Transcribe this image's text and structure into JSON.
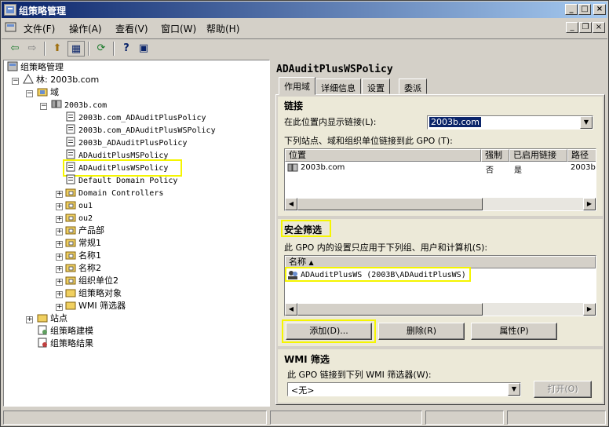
{
  "window": {
    "title": "组策略管理",
    "min_label": "_",
    "max_label": "□",
    "close_label": "×",
    "mdi_min": "_",
    "mdi_restore": "❐",
    "mdi_close": "×"
  },
  "menu": [
    {
      "label": "文件(F)"
    },
    {
      "label": "操作(A)"
    },
    {
      "label": "查看(V)"
    },
    {
      "label": "窗口(W)"
    },
    {
      "label": "帮助(H)"
    }
  ],
  "toolbar": {
    "back": "⇦",
    "forward": "⇨",
    "up": "⬆",
    "tree": "▦",
    "refresh": "⟳",
    "help": "?",
    "console": "▣"
  },
  "tree": {
    "root": "组策略管理",
    "forest": "林: 2003b.com",
    "domains": "域",
    "domain": "2003b.com",
    "gpos": [
      "2003b.com_ADAuditPlusPolicy",
      "2003b.com_ADAuditPlusWSPolicy",
      "2003b_ADAuditPlusPolicy",
      "ADAuditPlusMSPolicy",
      "ADAuditPlusWSPolicy",
      "Default Domain Policy"
    ],
    "ous": [
      "Domain Controllers",
      "ou1",
      "ou2",
      "产品部",
      "常规1",
      "名称1",
      "名称2",
      "组织单位2",
      "组策略对象",
      "WMI 筛选器"
    ],
    "sites": "站点",
    "modeling": "组策略建模",
    "results": "组策略结果"
  },
  "detail": {
    "title": "ADAuditPlusWSPolicy",
    "tabs": [
      "作用域",
      "详细信息",
      "设置",
      "委派"
    ],
    "links": {
      "heading": "链接",
      "show_label": "在此位置内显示链接(L):",
      "location_value": "2003b.com",
      "desc": "下列站点、域和组织单位链接到此 GPO (T):",
      "columns": [
        "位置",
        "强制",
        "已启用链接",
        "路径"
      ],
      "rows": [
        {
          "location": "2003b.com",
          "enforced": "否",
          "enabled": "是",
          "path": "2003b"
        }
      ]
    },
    "security": {
      "heading": "安全筛选",
      "desc": "此 GPO 内的设置只应用于下列组、用户和计算机(S):",
      "column": "名称",
      "rows": [
        "ADAuditPlusWS (2003B\\ADAuditPlusWS)"
      ],
      "add_btn": "添加(D)...",
      "remove_btn": "删除(R)",
      "props_btn": "属性(P)"
    },
    "wmi": {
      "heading": "WMI 筛选",
      "desc": "此 GPO 链接到下列 WMI 筛选器(W):",
      "value": "<无>",
      "open_btn": "打开(O)"
    }
  },
  "colors": {
    "highlight": "#f5f500",
    "title_start": "#0a246a",
    "title_end": "#a6caf0",
    "selection": "#0a246a"
  }
}
